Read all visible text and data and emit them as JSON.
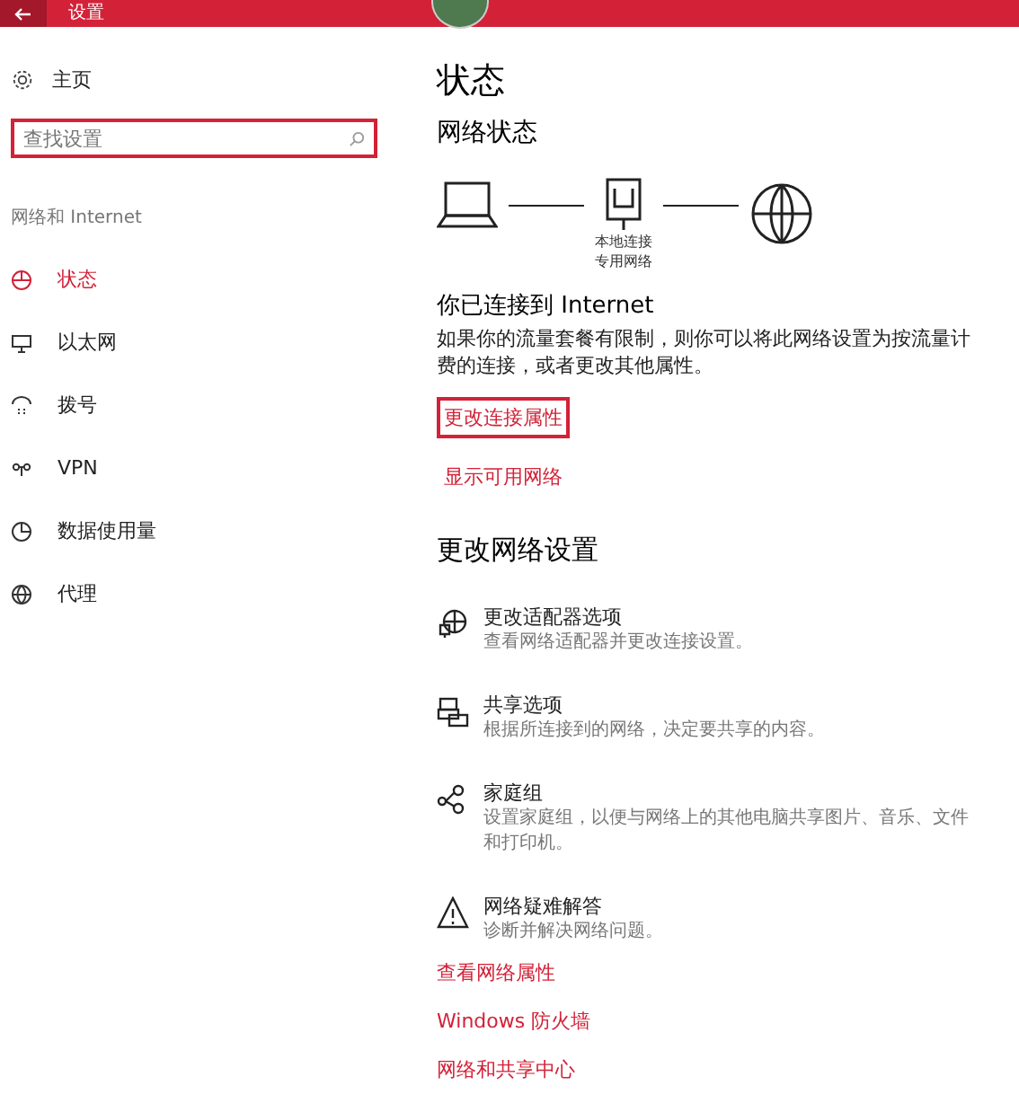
{
  "window": {
    "title": "设置"
  },
  "sidebar": {
    "home": "主页",
    "search": {
      "placeholder": "查找设置"
    },
    "section": "网络和 Internet",
    "items": [
      {
        "label": "状态",
        "kind": "status",
        "selected": true
      },
      {
        "label": "以太网",
        "kind": "ethernet",
        "selected": false
      },
      {
        "label": "拨号",
        "kind": "dialup",
        "selected": false
      },
      {
        "label": "VPN",
        "kind": "vpn",
        "selected": false
      },
      {
        "label": "数据使用量",
        "kind": "data",
        "selected": false
      },
      {
        "label": "代理",
        "kind": "proxy",
        "selected": false
      }
    ]
  },
  "main": {
    "title": "状态",
    "network_status": {
      "heading": "网络状态",
      "connection_labels": [
        "本地连接",
        "专用网络"
      ]
    },
    "connected": {
      "heading": "你已连接到 Internet",
      "description": "如果你的流量套餐有限制，则你可以将此网络设置为按流量计费的连接，或者更改其他属性。"
    },
    "links": [
      {
        "label": "更改连接属性",
        "highlighted": true
      },
      {
        "label": "显示可用网络",
        "highlighted": false
      }
    ],
    "settings_heading": "更改网络设置",
    "options": [
      {
        "kind": "adapter",
        "title": "更改适配器选项",
        "description": "查看网络适配器并更改连接设置。"
      },
      {
        "kind": "sharing",
        "title": "共享选项",
        "description": "根据所连接到的网络，决定要共享的内容。"
      },
      {
        "kind": "homegroup",
        "title": "家庭组",
        "description": "设置家庭组，以便与网络上的其他电脑共享图片、音乐、文件和打印机。"
      },
      {
        "kind": "troubleshoot",
        "title": "网络疑难解答",
        "description": "诊断并解决网络问题。"
      }
    ],
    "bottom_links": [
      "查看网络属性",
      "Windows 防火墙",
      "网络和共享中心"
    ]
  }
}
